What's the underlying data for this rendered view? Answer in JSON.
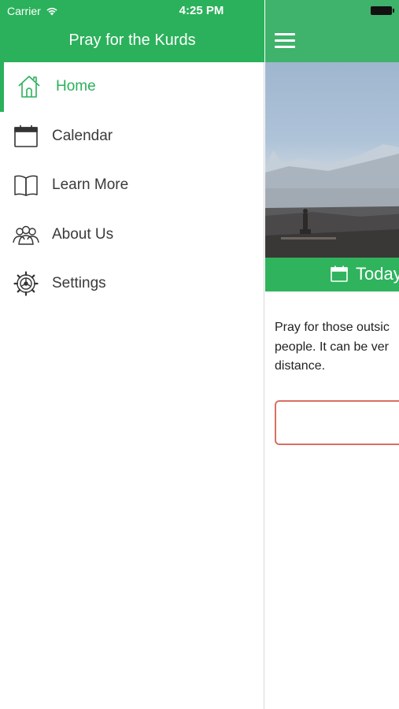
{
  "status_bar": {
    "carrier": "Carrier",
    "time": "4:25 PM"
  },
  "drawer": {
    "title": "Pray for the Kurds",
    "items": [
      {
        "label": "Home",
        "icon": "home-icon",
        "active": true
      },
      {
        "label": "Calendar",
        "icon": "calendar-icon",
        "active": false
      },
      {
        "label": "Learn More",
        "icon": "book-icon",
        "active": false
      },
      {
        "label": "About Us",
        "icon": "people-icon",
        "active": false
      },
      {
        "label": "Settings",
        "icon": "gear-icon",
        "active": false
      }
    ]
  },
  "main": {
    "date_label": "Today",
    "prayer_lines": [
      "Pray for those outsic",
      "people. It can be ver",
      "distance."
    ]
  },
  "colors": {
    "brand_green": "#2bb15b",
    "text": "#3a3a3a",
    "button_border": "#d96f63"
  }
}
